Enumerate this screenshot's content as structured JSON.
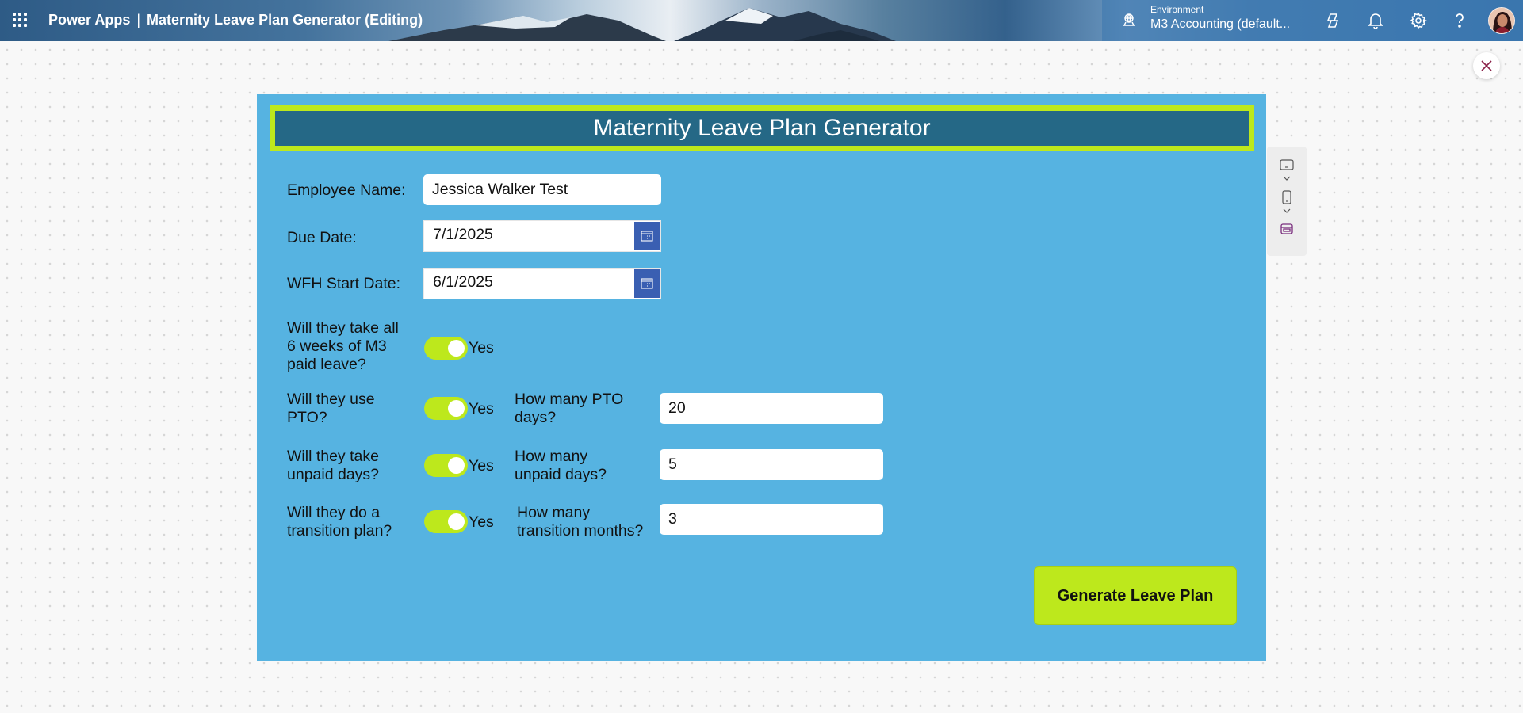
{
  "header": {
    "product": "Power Apps",
    "separator": "|",
    "app_name": "Maternity Leave Plan Generator (Editing)",
    "environment_label": "Environment",
    "environment_value": "M3 Accounting (default..."
  },
  "icons": {
    "waffle": "app-launcher-icon",
    "environment": "environment-icon",
    "copilot": "copilot-icon",
    "notifications": "bell-icon",
    "settings": "gear-icon",
    "help": "help-icon",
    "close": "close-icon",
    "calendar": "calendar-icon"
  },
  "colors": {
    "canvas_bg": "#56b3e1",
    "title_bg": "#256886",
    "accent": "#bde81c",
    "calendar_button": "#3a5fb2"
  },
  "form": {
    "title": "Maternity Leave Plan Generator",
    "employee_name_label": "Employee Name:",
    "employee_name_value": "Jessica Walker Test",
    "due_date_label": "Due Date:",
    "due_date_value": "7/1/2025",
    "wfh_start_label": "WFH Start Date:",
    "wfh_start_value": "6/1/2025",
    "paid_leave_question_line1": "Will they take all",
    "paid_leave_question_line2": "6 weeks of M3",
    "paid_leave_question_line3": "paid leave?",
    "paid_leave_toggle": "Yes",
    "pto_question_line1": "Will they use",
    "pto_question_line2": "PTO?",
    "pto_toggle": "Yes",
    "pto_days_label_line1": "How many PTO",
    "pto_days_label_line2": "days?",
    "pto_days_value": "20",
    "unpaid_question_line1": "Will they take",
    "unpaid_question_line2": "unpaid days?",
    "unpaid_toggle": "Yes",
    "unpaid_days_label_line1": "How many",
    "unpaid_days_label_line2": "unpaid days?",
    "unpaid_days_value": "5",
    "transition_question_line1": "Will they do a",
    "transition_question_line2": "transition plan?",
    "transition_toggle": "Yes",
    "transition_months_label_line1": "How many",
    "transition_months_label_line2": "transition months?",
    "transition_months_value": "3",
    "generate_button": "Generate Leave Plan"
  }
}
